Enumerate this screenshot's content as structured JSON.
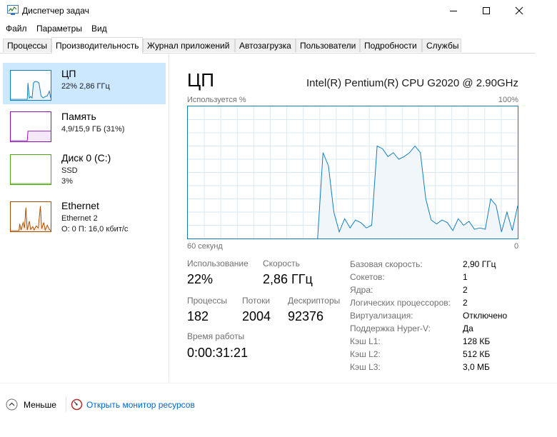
{
  "window": {
    "title": "Диспетчер задач",
    "controls": {
      "minimize": "minimize-icon",
      "maximize": "maximize-icon",
      "close": "close-icon"
    }
  },
  "menu": [
    "Файл",
    "Параметры",
    "Вид"
  ],
  "tabs": [
    "Процессы",
    "Производительность",
    "Журнал приложений",
    "Автозагрузка",
    "Пользователи",
    "Подробности",
    "Службы"
  ],
  "active_tab": "Производительность",
  "sidebar": [
    {
      "name": "ЦП",
      "line1": "22% 2,86 ГГц",
      "line2": "",
      "color": "#117dbb",
      "selected": true
    },
    {
      "name": "Память",
      "line1": "4,9/15,9 ГБ (31%)",
      "line2": "",
      "color": "#8b12ae",
      "selected": false
    },
    {
      "name": "Диск 0 (C:)",
      "line1": "SSD",
      "line2": "3%",
      "color": "#4da60c",
      "selected": false
    },
    {
      "name": "Ethernet",
      "line1": "Ethernet 2",
      "line2": "О: 0 П: 16,0 кбит/с",
      "color": "#a74f01",
      "selected": false
    }
  ],
  "cpu": {
    "title": "ЦП",
    "model": "Intel(R) Pentium(R) CPU G2020 @ 2.90GHz",
    "graph_label_left": "Используется %",
    "graph_label_right": "100%",
    "axis_left": "60 секунд",
    "axis_right": "0",
    "usage_percent_history": [
      0,
      0,
      0,
      0,
      0,
      0,
      0,
      0,
      0,
      0,
      0,
      0,
      0,
      0,
      0,
      0,
      0,
      0,
      0,
      0,
      0,
      0,
      0,
      0,
      0,
      65,
      55,
      20,
      5,
      15,
      8,
      14,
      12,
      8,
      10,
      70,
      68,
      62,
      65,
      60,
      62,
      65,
      70,
      65,
      30,
      14,
      11,
      14,
      12,
      6,
      15,
      10,
      13,
      7,
      8,
      7,
      30,
      25,
      5,
      20,
      6,
      25
    ],
    "stats": {
      "usage_label": "Использование",
      "usage_value": "22%",
      "speed_label": "Скорость",
      "speed_value": "2,86 ГГц",
      "processes_label": "Процессы",
      "processes_value": "182",
      "threads_label": "Потоки",
      "threads_value": "2004",
      "handles_label": "Дескрипторы",
      "handles_value": "92376",
      "uptime_label": "Время работы",
      "uptime_value": "0:00:31:21"
    },
    "properties": [
      {
        "label": "Базовая скорость:",
        "value": "2,90 ГГц"
      },
      {
        "label": "Сокетов:",
        "value": "1"
      },
      {
        "label": "Ядра:",
        "value": "2"
      },
      {
        "label": "Логических процессоров:",
        "value": "2"
      },
      {
        "label": "Виртуализация:",
        "value": "Отключено"
      },
      {
        "label": "Поддержка Hyper-V:",
        "value": "Да"
      },
      {
        "label": "Кэш L1:",
        "value": "128 КБ"
      },
      {
        "label": "Кэш L2:",
        "value": "512 КБ"
      },
      {
        "label": "Кэш L3:",
        "value": "3,0 МБ"
      }
    ]
  },
  "footer": {
    "less": "Меньше",
    "resource_monitor": "Открыть монитор ресурсов"
  },
  "colors": {
    "cpu_accent": "#117dbb",
    "link": "#0066cc",
    "selected_bg": "#cce8ff"
  }
}
